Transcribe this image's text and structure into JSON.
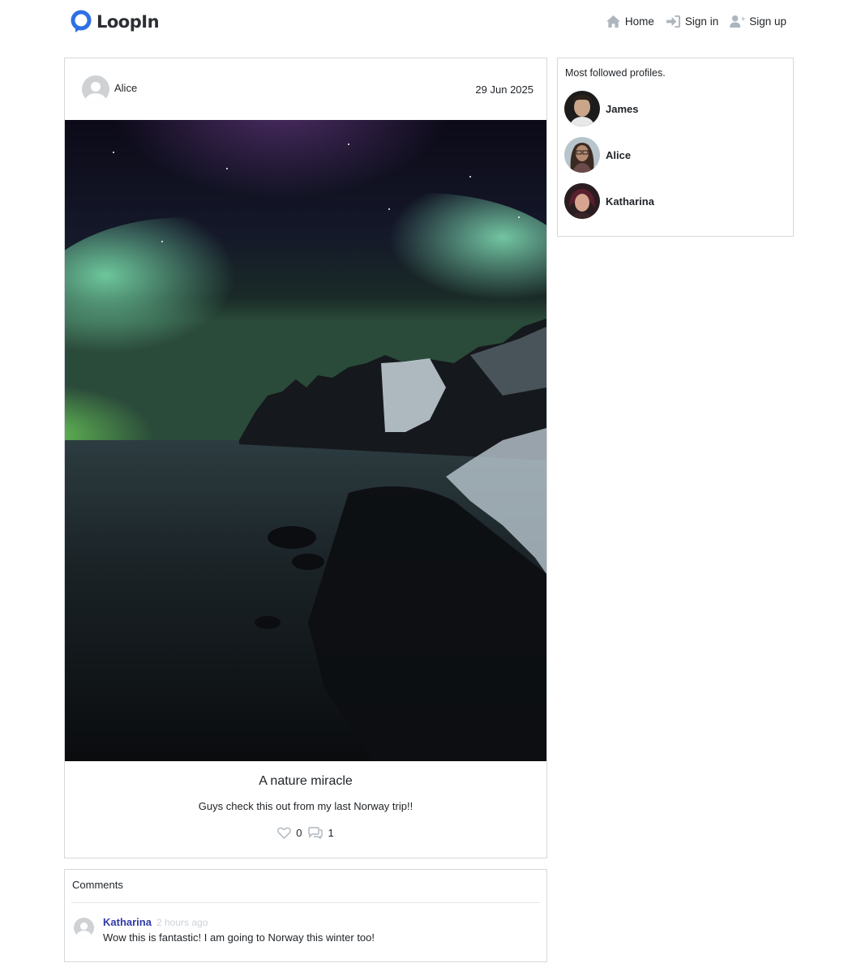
{
  "header": {
    "brand": "LoopIn",
    "nav": [
      {
        "label": "Home",
        "icon": "home-icon"
      },
      {
        "label": "Sign in",
        "icon": "sign-in-icon"
      },
      {
        "label": "Sign up",
        "icon": "user-plus-icon"
      }
    ]
  },
  "post": {
    "author": "Alice",
    "date": "29 Jun 2025",
    "image": "aurora-borealis-photo",
    "title": "A nature miracle",
    "text": "Guys check this out from my last Norway trip!!",
    "likes": "0",
    "comments": "1"
  },
  "comments": {
    "title": "Comments",
    "items": [
      {
        "author": "Katharina",
        "time": "2 hours ago",
        "text": "Wow this is fantastic! I am going to Norway this winter too!"
      }
    ]
  },
  "sidebar": {
    "title": "Most followed profiles.",
    "profiles": [
      {
        "name": "James"
      },
      {
        "name": "Alice"
      },
      {
        "name": "Katharina"
      }
    ]
  },
  "colors": {
    "brand": "#2f6fe4",
    "comment_author": "#2f3aa6",
    "icon_gray": "#adb5bd",
    "border": "#d5d8db"
  }
}
